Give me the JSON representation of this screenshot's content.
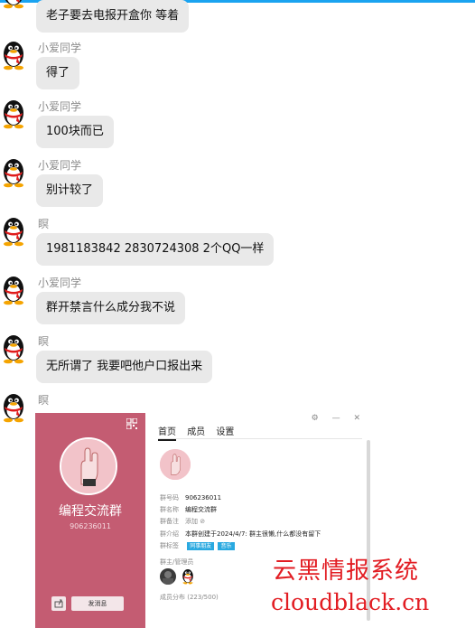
{
  "messages": [
    {
      "sender": "",
      "text": "老子要去电报开盒你 等着"
    },
    {
      "sender": "小爱同学",
      "text": "得了"
    },
    {
      "sender": "小爱同学",
      "text": "100块而已"
    },
    {
      "sender": "小爱同学",
      "text": "别计较了"
    },
    {
      "sender": "瞑",
      "text": "1981183842 2830724308 2个QQ一样"
    },
    {
      "sender": "小爱同学",
      "text": "群开禁言什么成分我不说"
    },
    {
      "sender": "瞑",
      "text": "无所谓了 我要吧他户口报出来"
    },
    {
      "sender": "瞑",
      "text": ""
    }
  ],
  "screenshot": {
    "group_name": "编程交流群",
    "group_id": "906236011",
    "send_button": "发消息",
    "tabs": [
      "首页",
      "成员",
      "设置"
    ],
    "window_controls": "⚙ — ✕",
    "info": [
      {
        "key": "群号码",
        "value": "906236011"
      },
      {
        "key": "群名称",
        "value": "编程交流群"
      },
      {
        "key": "群备注",
        "value": "添加 ⊘"
      },
      {
        "key": "群介绍",
        "value": "本群创建于2024/4/7: 群主很懒,什么都没有留下"
      },
      {
        "key": "群标签",
        "value": ""
      }
    ],
    "tags": [
      "同事朋友",
      "音乐"
    ],
    "admins_label": "群主/管理员",
    "members_label": "成员分布 (223/500)"
  },
  "watermark": {
    "line1": "云黑情报系统",
    "line2": "cloudblack.cn",
    "color": "#e21d23"
  }
}
